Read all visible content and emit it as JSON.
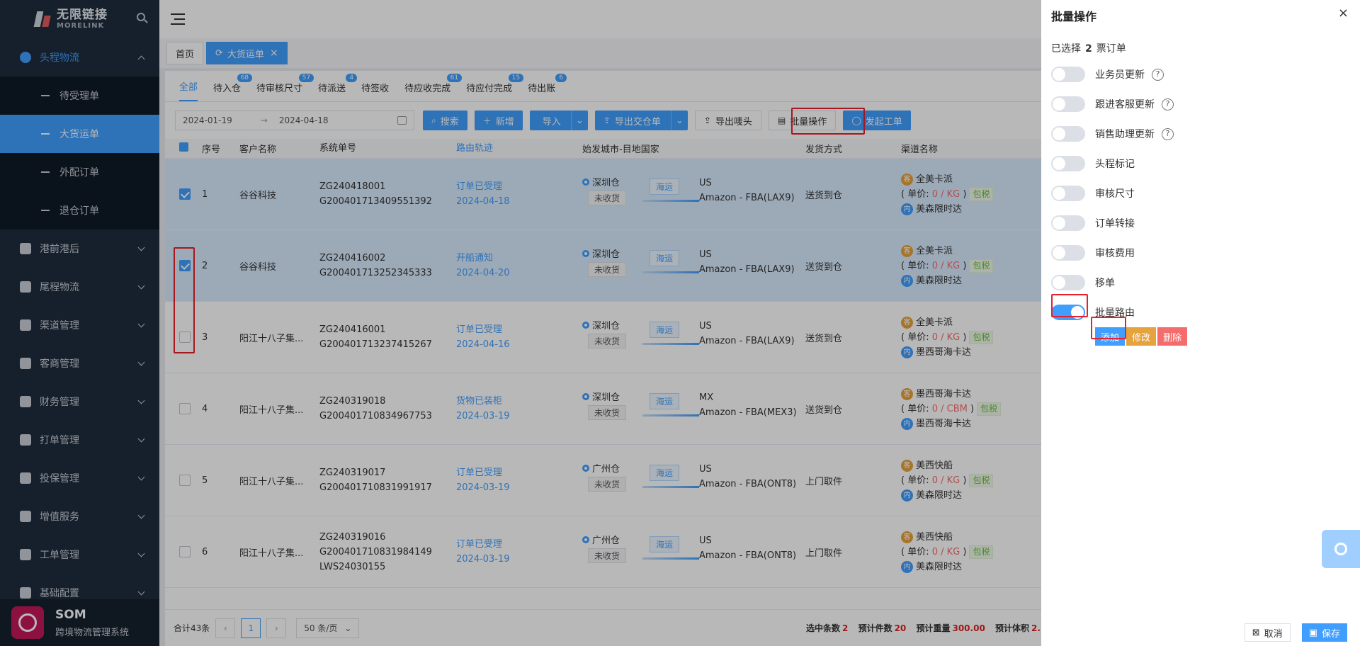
{
  "brand": {
    "name": "无限链接",
    "sub": "MORELINK"
  },
  "sidebar": {
    "groups": [
      {
        "label": "头程物流",
        "icon": "globe-icon",
        "open": true,
        "children": [
          "待受理单",
          "大货运单",
          "外配订单",
          "退仓订单"
        ],
        "active_child": 1
      },
      {
        "label": "港前港后",
        "icon": "grid-icon"
      },
      {
        "label": "尾程物流",
        "icon": "home-icon"
      },
      {
        "label": "渠道管理",
        "icon": "route-icon"
      },
      {
        "label": "客商管理",
        "icon": "people-icon"
      },
      {
        "label": "财务管理",
        "icon": "yen-icon"
      },
      {
        "label": "打单管理",
        "icon": "calendar-icon"
      },
      {
        "label": "投保管理",
        "icon": "shield-icon"
      },
      {
        "label": "增值服务",
        "icon": "heart-icon"
      },
      {
        "label": "工单管理",
        "icon": "user-icon"
      },
      {
        "label": "基础配置",
        "icon": "layers-icon"
      }
    ],
    "footer": {
      "name": "SOM",
      "subtitle": "跨境物流管理系统"
    }
  },
  "tagbar": {
    "home": "首页",
    "current": "大货运单"
  },
  "tabs": [
    {
      "label": "全部",
      "badge": null
    },
    {
      "label": "待入仓",
      "badge": "68"
    },
    {
      "label": "待审核尺寸",
      "badge": "57"
    },
    {
      "label": "待派送",
      "badge": "4"
    },
    {
      "label": "待签收",
      "badge": null
    },
    {
      "label": "待应收完成",
      "badge": "61"
    },
    {
      "label": "待应付完成",
      "badge": "15"
    },
    {
      "label": "待出账",
      "badge": "6"
    }
  ],
  "toolbar": {
    "date_start": "2024-01-19",
    "date_arrow": "→",
    "date_end": "2024-04-18",
    "search": "搜索",
    "add": "新增",
    "import": "导入",
    "export_handover": "导出交仓单",
    "export_marks": "导出唛头",
    "batch": "批量操作",
    "ticket": "发起工单"
  },
  "table": {
    "headers": [
      "序号",
      "客户名称",
      "系统单号",
      "路由轨迹",
      "始发城市-目地国家",
      "发货方式",
      "渠道名称"
    ],
    "rows": [
      {
        "no": "1",
        "customer": "谷谷科技",
        "sys": [
          "ZG240418001",
          "G200401713409551392"
        ],
        "route": "订单已受理",
        "date": "2024-04-18",
        "wh": "深圳仓",
        "status": "未收货",
        "mode": "海运",
        "country": "US",
        "fba": "Amazon - FBA(LAX9)",
        "ship": "送货到仓",
        "ch1": "全美卡派",
        "unit": "0 / KG",
        "tax": "包税",
        "ch2": "美森限时达",
        "selected": true
      },
      {
        "no": "2",
        "customer": "谷谷科技",
        "sys": [
          "ZG240416002",
          "G200401713252345333"
        ],
        "route": "开船通知",
        "date": "2024-04-20",
        "wh": "深圳仓",
        "status": "未收货",
        "mode": "海运",
        "country": "US",
        "fba": "Amazon - FBA(LAX9)",
        "ship": "送货到仓",
        "ch1": "全美卡派",
        "unit": "0 / KG",
        "tax": "包税",
        "ch2": "美森限时达",
        "selected": true
      },
      {
        "no": "3",
        "customer": "阳江十八子集...",
        "sys": [
          "ZG240416001",
          "G200401713237415267"
        ],
        "route": "订单已受理",
        "date": "2024-04-16",
        "wh": "深圳仓",
        "status": "未收货",
        "mode": "海运",
        "country": "US",
        "fba": "Amazon - FBA(LAX9)",
        "ship": "送货到仓",
        "ch1": "全美卡派",
        "unit": "0 / KG",
        "tax": "包税",
        "ch2": "墨西哥海卡达",
        "selected": false
      },
      {
        "no": "4",
        "customer": "阳江十八子集...",
        "sys": [
          "ZG240319018",
          "G200401710834967753"
        ],
        "route": "货物已装柜",
        "date": "2024-03-19",
        "wh": "深圳仓",
        "status": "未收货",
        "mode": "海运",
        "country": "MX",
        "fba": "Amazon - FBA(MEX3)",
        "ship": "送货到仓",
        "ch1": "墨西哥海卡达",
        "unit": "0 / CBM",
        "tax": "包税",
        "ch2": "墨西哥海卡达",
        "selected": false
      },
      {
        "no": "5",
        "customer": "阳江十八子集...",
        "sys": [
          "ZG240319017",
          "G200401710831991917"
        ],
        "route": "订单已受理",
        "date": "2024-03-19",
        "wh": "广州仓",
        "status": "未收货",
        "mode": "海运",
        "country": "US",
        "fba": "Amazon - FBA(ONT8)",
        "ship": "上门取件",
        "ch1": "美西快船",
        "unit": "0 / KG",
        "tax": "包税",
        "ch2": "美森限时达",
        "selected": false
      },
      {
        "no": "6",
        "customer": "阳江十八子集...",
        "sys": [
          "ZG240319016",
          "G200401710831984149",
          "LWS24030155"
        ],
        "route": "订单已受理",
        "date": "2024-03-19",
        "wh": "广州仓",
        "status": "未收货",
        "mode": "海运",
        "country": "US",
        "fba": "Amazon - FBA(ONT8)",
        "ship": "上门取件",
        "ch1": "美西快船",
        "unit": "0 / KG",
        "tax": "包税",
        "ch2": "美森限时达",
        "selected": false
      }
    ],
    "unit_prefix": "( 单价: ",
    "unit_suffix": " )"
  },
  "pager": {
    "total": "合计43条",
    "page": "1",
    "size": "50 条/页",
    "sel_label": "选中条数",
    "sel": "2",
    "pcs_label": "预计件数",
    "pcs": "20",
    "weight_label": "预计重量",
    "weight": "300.00",
    "vol_label": "预计体积",
    "vol": "2."
  },
  "drawer": {
    "title": "批量操作",
    "close": "×",
    "selected_prefix": "已选择",
    "selected_count": "2",
    "selected_suffix": "票订单",
    "switches": [
      {
        "label": "业务员更新",
        "on": false,
        "help": true
      },
      {
        "label": "跟进客服更新",
        "on": false,
        "help": true
      },
      {
        "label": "销售助理更新",
        "on": false,
        "help": true
      },
      {
        "label": "头程标记",
        "on": false,
        "help": false
      },
      {
        "label": "审核尺寸",
        "on": false,
        "help": false
      },
      {
        "label": "订单转接",
        "on": false,
        "help": false
      },
      {
        "label": "审核费用",
        "on": false,
        "help": false
      },
      {
        "label": "移单",
        "on": false,
        "help": false
      },
      {
        "label": "批量路由",
        "on": true,
        "help": false
      }
    ],
    "route_buttons": {
      "add": "添加",
      "edit": "修改",
      "delete": "删除"
    },
    "cancel": "取消",
    "save": "保存"
  },
  "colors": {
    "primary": "#409eff",
    "sidebar": "#1f2d3d",
    "danger": "#f56c6c",
    "warning": "#e6a23c",
    "highlight": "#e8202a"
  }
}
